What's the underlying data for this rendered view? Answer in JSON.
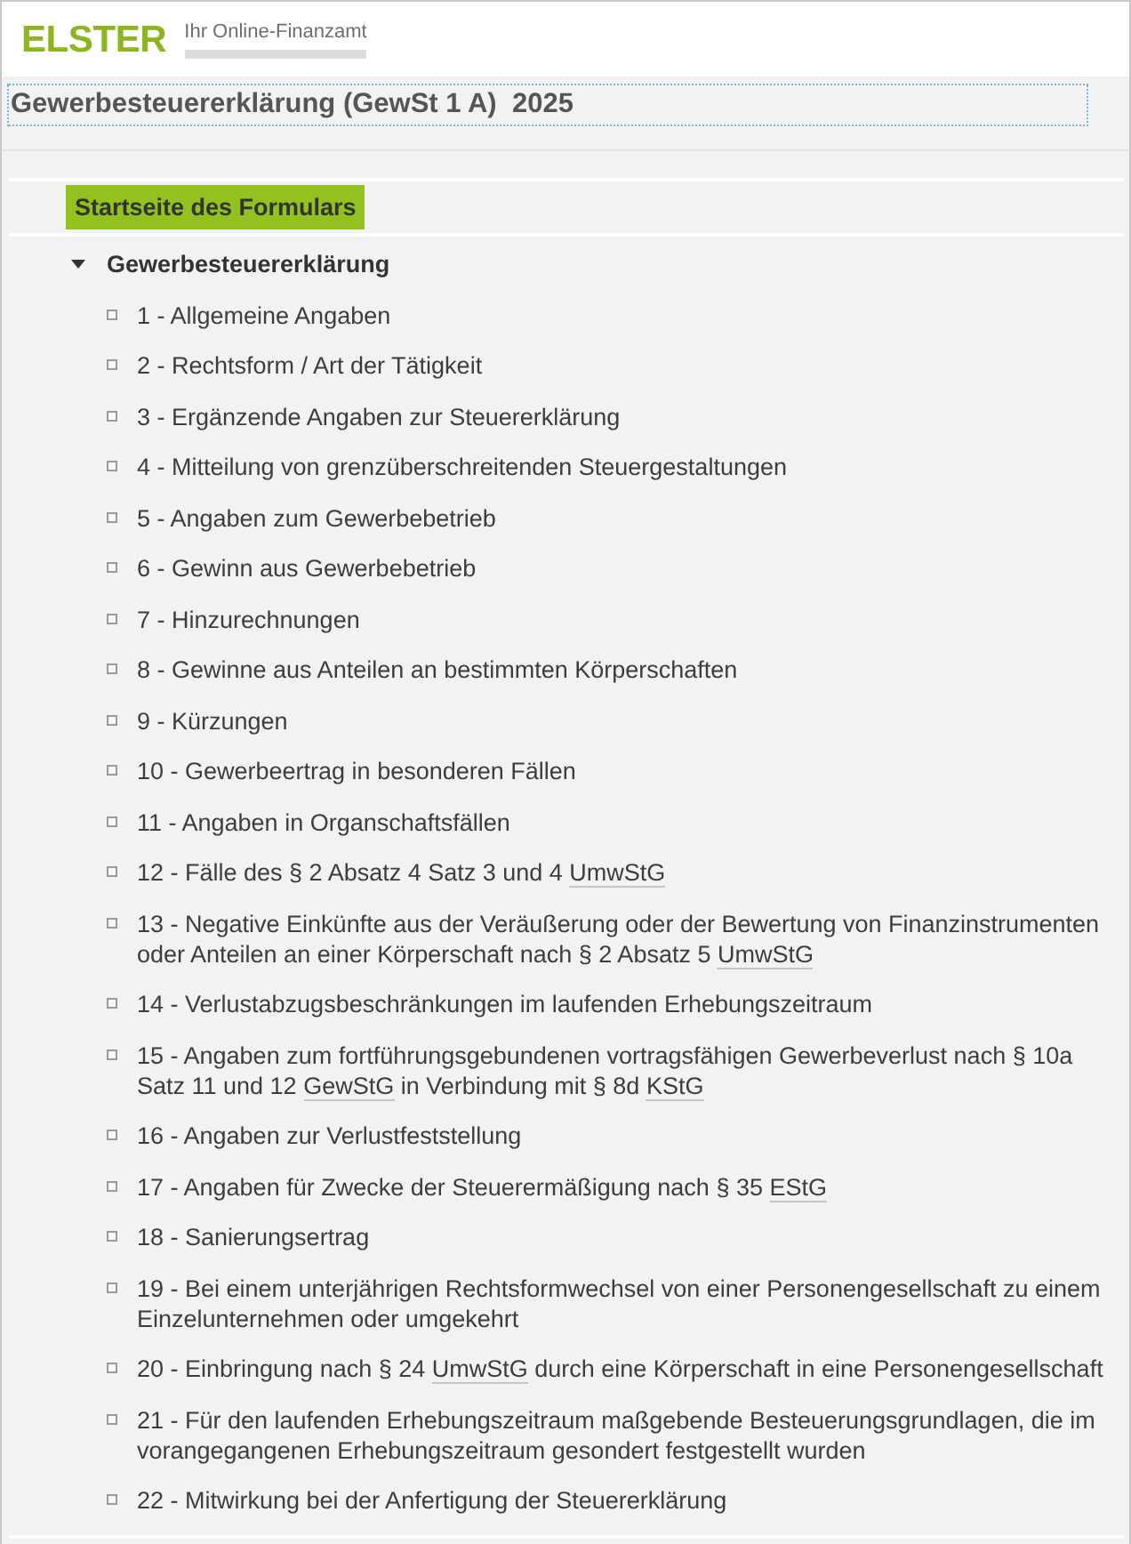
{
  "header": {
    "logo": "ELSTER",
    "tagline": "Ihr Online-Finanzamt"
  },
  "form_title": "Gewerbesteuererklärung (GewSt 1 A)  2025",
  "start_button": {
    "label": "Startseite des Formulars"
  },
  "tree": {
    "label": "Gewerbesteuererklärung",
    "expanded": true,
    "children": [
      {
        "parts": [
          {
            "kind": "text",
            "text": "1 - Allgemeine Angaben"
          }
        ]
      },
      {
        "parts": [
          {
            "kind": "text",
            "text": "2 - Rechtsform / Art der Tätigkeit"
          }
        ]
      },
      {
        "parts": [
          {
            "kind": "text",
            "text": "3 - Ergänzende Angaben zur Steuererklärung"
          }
        ]
      },
      {
        "parts": [
          {
            "kind": "text",
            "text": "4 - Mitteilung von grenzüberschreitenden Steuergestaltungen"
          }
        ]
      },
      {
        "parts": [
          {
            "kind": "text",
            "text": "5 - Angaben zum Gewerbebetrieb"
          }
        ]
      },
      {
        "parts": [
          {
            "kind": "text",
            "text": "6 - Gewinn aus Gewerbebetrieb"
          }
        ]
      },
      {
        "parts": [
          {
            "kind": "text",
            "text": "7 - Hinzurechnungen"
          }
        ]
      },
      {
        "parts": [
          {
            "kind": "text",
            "text": "8 - Gewinne aus Anteilen an bestimmten Körperschaften"
          }
        ]
      },
      {
        "parts": [
          {
            "kind": "text",
            "text": "9 - Kürzungen"
          }
        ]
      },
      {
        "parts": [
          {
            "kind": "text",
            "text": "10 - Gewerbeertrag in besonderen Fällen"
          }
        ]
      },
      {
        "parts": [
          {
            "kind": "text",
            "text": "11 - Angaben in Organschaftsfällen"
          }
        ]
      },
      {
        "parts": [
          {
            "kind": "text",
            "text": "12 - Fälle des § 2 Absatz 4 Satz 3 und 4 "
          },
          {
            "kind": "abbr",
            "text": "UmwStG"
          }
        ]
      },
      {
        "parts": [
          {
            "kind": "text",
            "text": "13 - Negative Einkünfte aus der Veräußerung oder der Bewertung von Finanzinstrumenten oder Anteilen an einer Körperschaft nach § 2 Absatz 5 "
          },
          {
            "kind": "abbr",
            "text": "UmwStG"
          }
        ]
      },
      {
        "parts": [
          {
            "kind": "text",
            "text": "14 - Verlustabzugsbeschränkungen im laufenden Erhebungszeitraum"
          }
        ]
      },
      {
        "parts": [
          {
            "kind": "text",
            "text": "15 - Angaben zum fortführungsgebundenen vortragsfähigen Gewerbeverlust nach § 10a Satz 11 und 12 "
          },
          {
            "kind": "abbr",
            "text": "GewStG"
          },
          {
            "kind": "text",
            "text": " in Verbindung mit § 8d "
          },
          {
            "kind": "abbr",
            "text": "KStG"
          }
        ]
      },
      {
        "parts": [
          {
            "kind": "text",
            "text": "16 - Angaben zur Verlustfeststellung"
          }
        ]
      },
      {
        "parts": [
          {
            "kind": "text",
            "text": "17 - Angaben für Zwecke der Steuerermäßigung nach § 35 "
          },
          {
            "kind": "abbr",
            "text": "EStG"
          }
        ]
      },
      {
        "parts": [
          {
            "kind": "text",
            "text": "18 - Sanierungsertrag"
          }
        ]
      },
      {
        "parts": [
          {
            "kind": "text",
            "text": "19 - Bei einem unterjährigen Rechtsformwechsel von einer Personengesellschaft zu einem Einzelunternehmen oder umgekehrt"
          }
        ]
      },
      {
        "parts": [
          {
            "kind": "text",
            "text": "20 - Einbringung nach § 24 "
          },
          {
            "kind": "abbr",
            "text": "UmwStG"
          },
          {
            "kind": "text",
            "text": " durch eine Körperschaft in eine Personengesellschaft"
          }
        ]
      },
      {
        "parts": [
          {
            "kind": "text",
            "text": "21 - Für den laufenden Erhebungszeitraum maßgebende Besteuerungsgrundlagen, die im vorangegangenen Erhebungszeitraum gesondert festgestellt wurden"
          }
        ]
      },
      {
        "parts": [
          {
            "kind": "text",
            "text": "22 - Mitwirkung bei der Anfertigung der Steuererklärung"
          }
        ]
      }
    ]
  }
}
